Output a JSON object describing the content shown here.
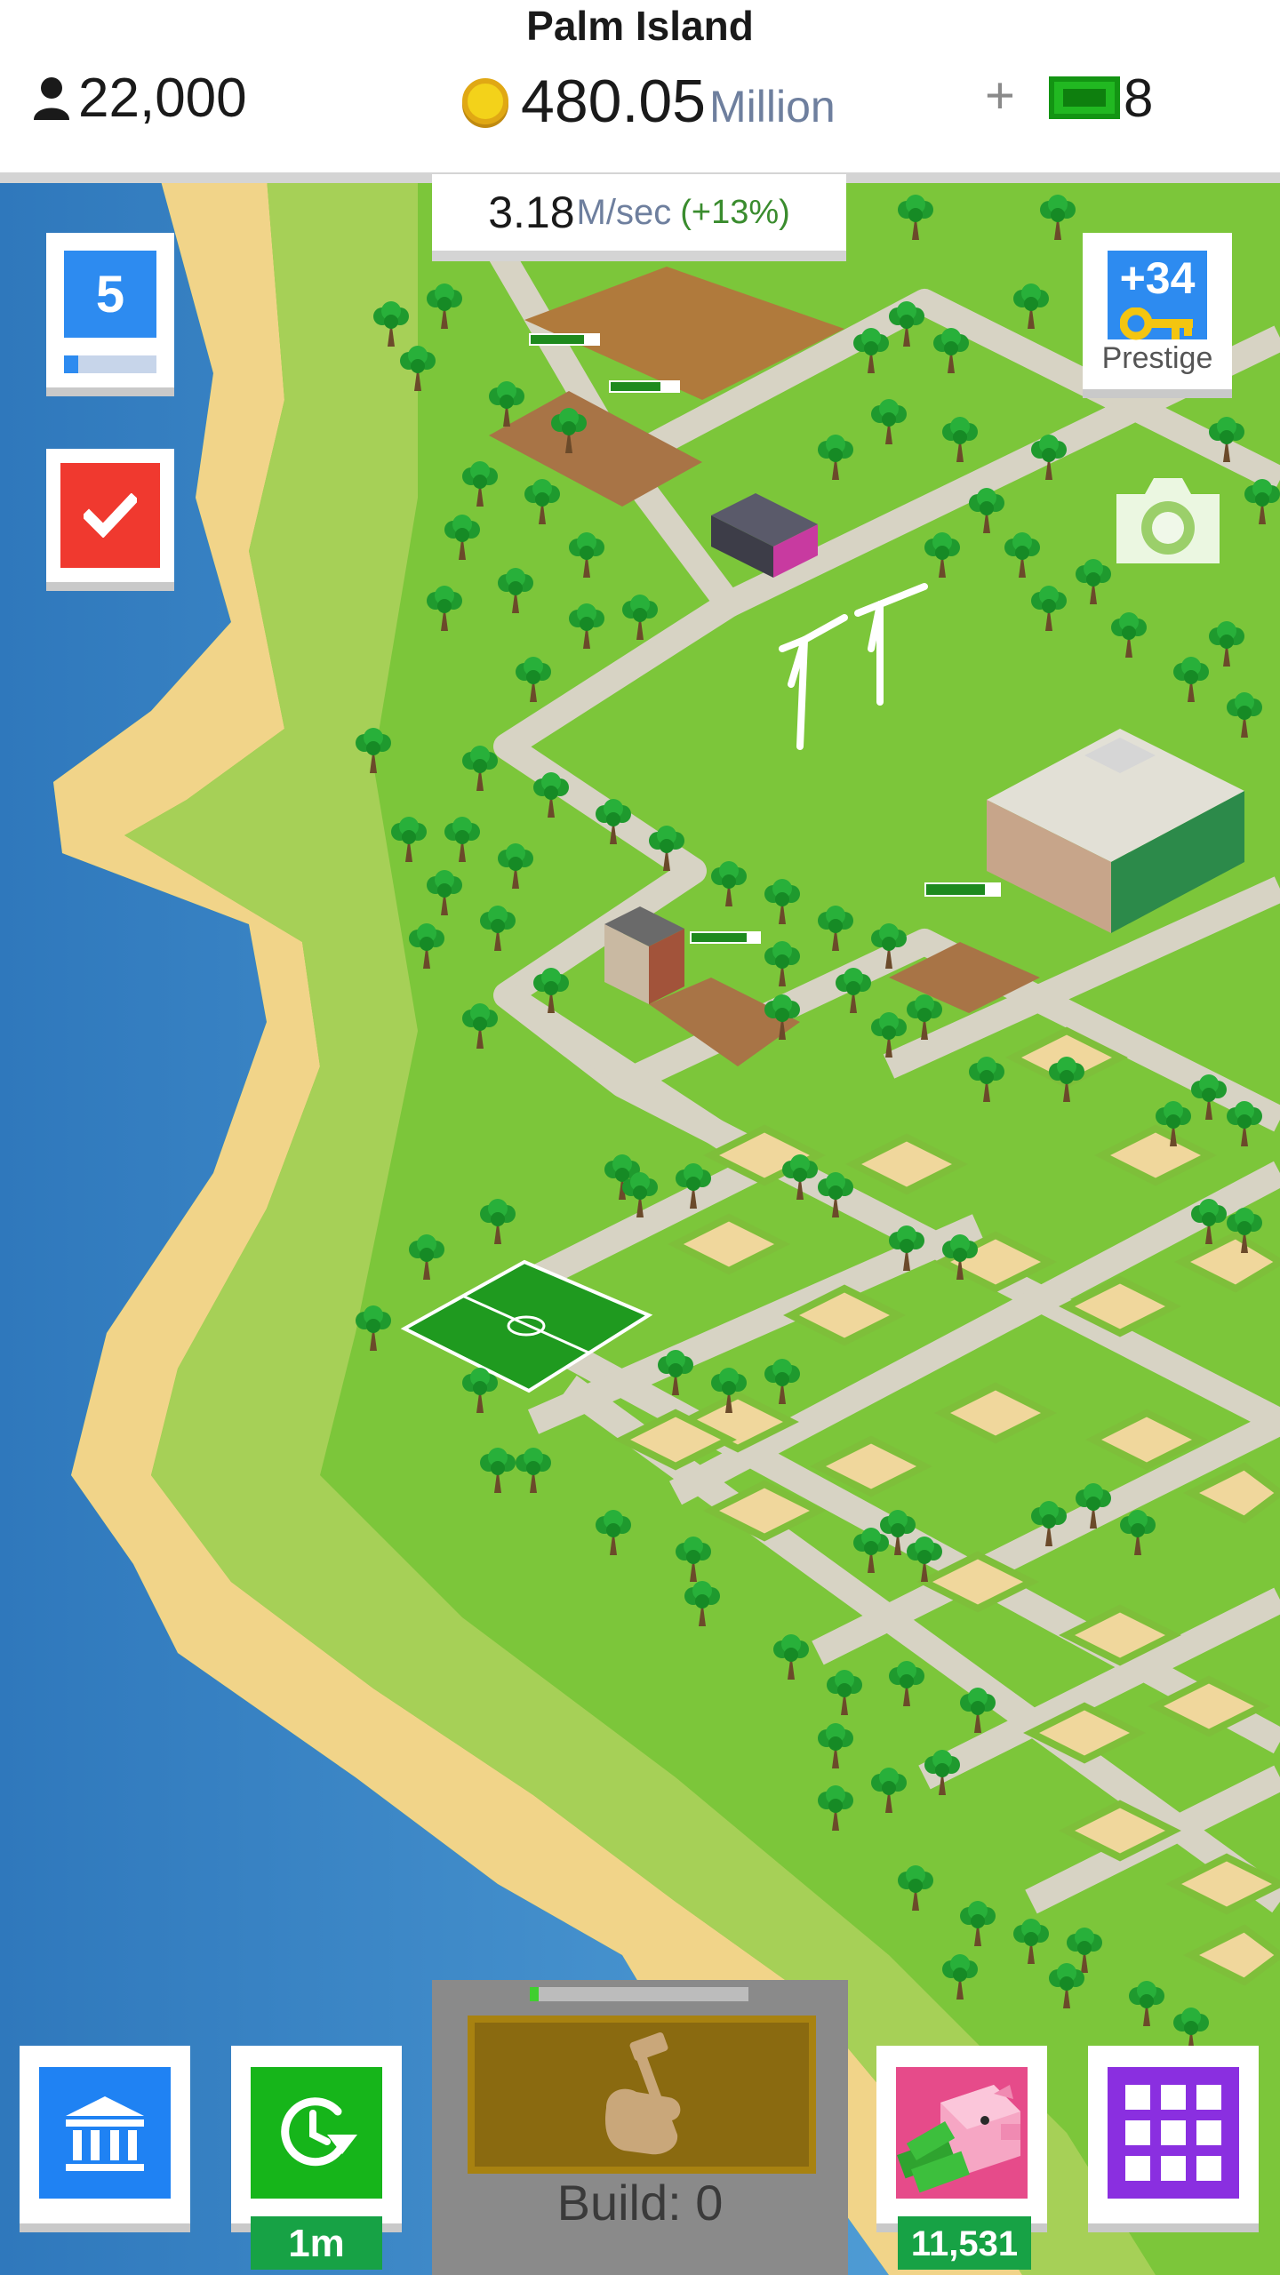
{
  "header": {
    "title": "Palm Island",
    "population": "22,000",
    "money_value": "480.05",
    "money_unit": "Million",
    "plus_label": "+",
    "cash_count": "8"
  },
  "income": {
    "value": "3.18",
    "unit": "M/sec",
    "bonus": "(+13%)"
  },
  "level": {
    "number": "5",
    "progress": 0.15
  },
  "prestige": {
    "value": "+34",
    "label": "Prestige"
  },
  "bottom": {
    "boost_time": "1m",
    "build_label": "Build: 0",
    "build_progress": 0.04,
    "piggy_value": "11,531"
  },
  "icons": {
    "population": "person-icon",
    "money": "coin-icon",
    "cash": "cash-icon",
    "tasks": "checkmark-icon",
    "prestige": "key-icon",
    "camera": "camera-icon",
    "bank": "bank-icon",
    "boost": "clock-refresh-icon",
    "build": "hammer-hand-icon",
    "piggy": "piggy-bank-icon",
    "menu": "grid-menu-icon"
  },
  "colors": {
    "primary_blue": "#2d8bf0",
    "red": "#f0392f",
    "green": "#16b51a",
    "purple": "#8a2fe0",
    "pink": "#e64b8a",
    "grass": "#7cc63a",
    "sand": "#f3d88a",
    "ocean": "#3a86c6"
  }
}
